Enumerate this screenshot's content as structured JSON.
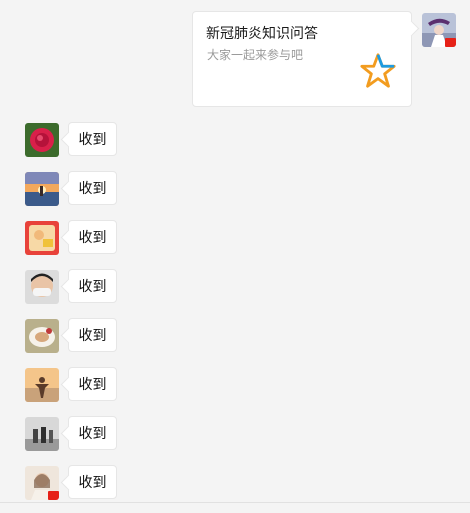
{
  "colors": {
    "background": "#f4f4f4",
    "bubble": "#ffffff",
    "bubble_border": "#e6e6e6",
    "star_blue": "#1e9be0",
    "star_orange": "#f29c1f"
  },
  "share_card": {
    "title": "新冠肺炎知识问答",
    "description": "大家一起来参与吧",
    "icon": "star-logo-icon"
  },
  "messages": [
    {
      "text": "收到",
      "avatar": "rose-flower-avatar"
    },
    {
      "text": "收到",
      "avatar": "sunset-sea-avatar"
    },
    {
      "text": "收到",
      "avatar": "celebration-avatar"
    },
    {
      "text": "收到",
      "avatar": "man-with-mask-avatar"
    },
    {
      "text": "收到",
      "avatar": "food-plate-avatar"
    },
    {
      "text": "收到",
      "avatar": "person-sunset-avatar"
    },
    {
      "text": "收到",
      "avatar": "street-people-avatar"
    },
    {
      "text": "收到",
      "avatar": "woman-portrait-avatar"
    }
  ]
}
